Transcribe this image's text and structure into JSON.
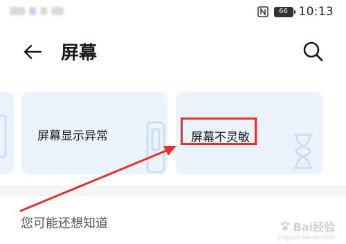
{
  "status_bar": {
    "battery_level": "66",
    "time": "10:13"
  },
  "header": {
    "title": "屏幕"
  },
  "cards": [
    {
      "label": "屏幕显示异常"
    },
    {
      "label": "屏幕不灵敏"
    }
  ],
  "section": {
    "title": "您可能还想知道"
  },
  "watermark": {
    "brand": "Bai经验",
    "site": "jingyan.baidu.com"
  },
  "colors": {
    "card_background": "#eaf2fb",
    "highlight": "#e8302b",
    "divider": "#f4f5f7"
  },
  "icons": {
    "back": "back-arrow-icon",
    "search": "search-icon",
    "nfc": "nfc-icon"
  }
}
